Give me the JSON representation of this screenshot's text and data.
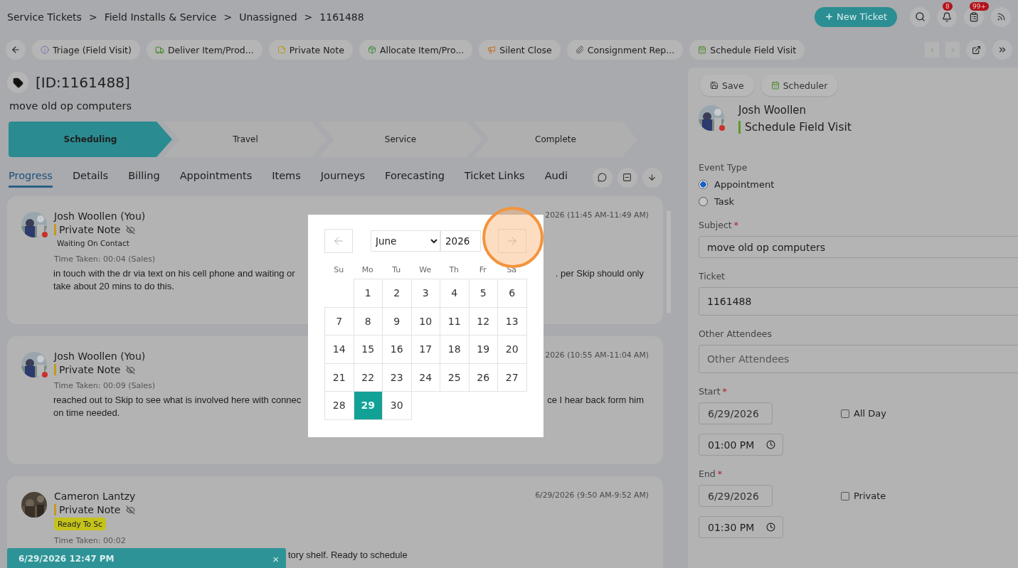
{
  "breadcrumb": {
    "separator": ">",
    "items": [
      "Service Tickets",
      "Field Installs & Service",
      "Unassigned",
      "1161488"
    ]
  },
  "new_ticket_button": {
    "label": "New Ticket"
  },
  "header_icons": [
    {
      "kind": "search"
    },
    {
      "kind": "bell",
      "badge": "8"
    },
    {
      "kind": "clipboard",
      "badge": "99+"
    },
    {
      "kind": "rss"
    }
  ],
  "actions": [
    {
      "kind": "info",
      "label": "Triage (Field Visit)"
    },
    {
      "kind": "truck",
      "label": "Deliver Item/Prod..."
    },
    {
      "kind": "note",
      "label": "Private Note"
    },
    {
      "kind": "box",
      "label": "Allocate Item/Pro..."
    },
    {
      "kind": "megaphone",
      "label": "Silent Close"
    },
    {
      "kind": "paperclip",
      "label": "Consignment Rep..."
    },
    {
      "kind": "calendar",
      "label": "Schedule Field Visit"
    }
  ],
  "ticket": {
    "id": "[ID:1161488]",
    "subject": "move old op computers"
  },
  "stages": [
    {
      "label": "Scheduling",
      "selected": true
    },
    {
      "label": "Travel",
      "selected": false
    },
    {
      "label": "Service",
      "selected": false
    },
    {
      "label": "Complete",
      "selected": false
    }
  ],
  "tabs": [
    {
      "label": "Progress",
      "selected": true
    },
    {
      "label": "Details",
      "selected": false
    },
    {
      "label": "Billing",
      "selected": false
    },
    {
      "label": "Appointments",
      "selected": false
    },
    {
      "label": "Items",
      "selected": false
    },
    {
      "label": "Journeys",
      "selected": false
    },
    {
      "label": "Forecasting",
      "selected": false
    },
    {
      "label": "Ticket Links",
      "selected": false
    },
    {
      "label": "Audi",
      "selected": false
    }
  ],
  "notes": [
    {
      "author": "Josh Woollen (You)",
      "status_badge": true,
      "type": "Private Note",
      "date": "2026 (11:45 AM-11:49 AM)",
      "tag": {
        "text": "Waiting On Contact"
      },
      "time_taken": "Time Taken: 00:04 (Sales)",
      "under_toast": false,
      "body": [
        [
          "in touch with the dr via text on his cell phone and waiting or",
          ".  per Skip should only"
        ],
        [
          "take about 20 mins to do this."
        ]
      ]
    },
    {
      "author": "Josh Woollen (You)",
      "status_badge": true,
      "type": "Private Note",
      "date": "2026 (10:55 AM-11:04 AM)",
      "time_taken": "Time Taken: 00:09 (Sales)",
      "under_toast": false,
      "body": [
        [
          "reached out to Skip to see what is involved here with connec",
          "ce I hear back form him"
        ],
        [
          "on time needed."
        ]
      ]
    },
    {
      "author": "Cameron Lantzy",
      "status_badge": false,
      "type": "Private Note",
      "date": "6/29/2026 (9:50 AM-9:52 AM)",
      "tag": {
        "text": "Ready To Sc",
        "color": "#c4c21b"
      },
      "time_taken": "Time Taken: 00:02",
      "under_toast": true,
      "body": [
        [
          "tory shelf. Ready to schedule"
        ]
      ]
    }
  ],
  "toast": {
    "text": "6/29/2026 12:47 PM",
    "close": "×"
  },
  "calendar": {
    "month": "June",
    "year": "2026",
    "weekdays": [
      "Su",
      "Mo",
      "Tu",
      "We",
      "Th",
      "Fr",
      "Sa"
    ],
    "days": [
      {
        "kind": "blank"
      },
      {
        "kind": "day",
        "label": "1",
        "selected": false
      },
      {
        "kind": "day",
        "label": "2",
        "selected": false
      },
      {
        "kind": "day",
        "label": "3",
        "selected": false
      },
      {
        "kind": "day",
        "label": "4",
        "selected": false
      },
      {
        "kind": "day",
        "label": "5",
        "selected": false
      },
      {
        "kind": "day",
        "label": "6",
        "selected": false
      },
      {
        "kind": "day",
        "label": "7",
        "selected": false
      },
      {
        "kind": "day",
        "label": "8",
        "selected": false
      },
      {
        "kind": "day",
        "label": "9",
        "selected": false
      },
      {
        "kind": "day",
        "label": "10",
        "selected": false
      },
      {
        "kind": "day",
        "label": "11",
        "selected": false
      },
      {
        "kind": "day",
        "label": "12",
        "selected": false
      },
      {
        "kind": "day",
        "label": "13",
        "selected": false
      },
      {
        "kind": "day",
        "label": "14",
        "selected": false
      },
      {
        "kind": "day",
        "label": "15",
        "selected": false
      },
      {
        "kind": "day",
        "label": "16",
        "selected": false
      },
      {
        "kind": "day",
        "label": "17",
        "selected": false
      },
      {
        "kind": "day",
        "label": "18",
        "selected": false
      },
      {
        "kind": "day",
        "label": "19",
        "selected": false
      },
      {
        "kind": "day",
        "label": "20",
        "selected": false
      },
      {
        "kind": "day",
        "label": "21",
        "selected": false
      },
      {
        "kind": "day",
        "label": "22",
        "selected": false
      },
      {
        "kind": "day",
        "label": "23",
        "selected": false
      },
      {
        "kind": "day",
        "label": "24",
        "selected": false
      },
      {
        "kind": "day",
        "label": "25",
        "selected": false
      },
      {
        "kind": "day",
        "label": "26",
        "selected": false
      },
      {
        "kind": "day",
        "label": "27",
        "selected": false
      },
      {
        "kind": "day",
        "label": "28",
        "selected": false
      },
      {
        "kind": "day",
        "label": "29",
        "selected": true
      },
      {
        "kind": "day",
        "label": "30",
        "selected": false
      }
    ]
  },
  "panel": {
    "buttons": [
      {
        "kind": "save",
        "label": "Save"
      },
      {
        "kind": "calendar",
        "label": "Scheduler"
      }
    ],
    "author": "Josh Woollen",
    "action": "Schedule Field Visit",
    "event_type": {
      "label": "Event Type",
      "options": [
        {
          "label": "Appointment",
          "selected": true
        },
        {
          "label": "Task",
          "selected": false
        }
      ]
    },
    "subject": {
      "label": "Subject",
      "required_mark": "*",
      "value": "move old op computers"
    },
    "ticket": {
      "label": "Ticket",
      "value": "1161488"
    },
    "attendees": {
      "label": "Other Attendees",
      "placeholder": "Other Attendees"
    },
    "start": {
      "label": "Start",
      "required_mark": "*",
      "date": "6/29/2026",
      "time": "01:00 PM",
      "option": {
        "label": "All Day",
        "checked": false
      }
    },
    "end": {
      "label": "End",
      "required_mark": "*",
      "date": "6/29/2026",
      "time": "01:30 PM",
      "option": {
        "label": "Private",
        "checked": false
      }
    }
  }
}
